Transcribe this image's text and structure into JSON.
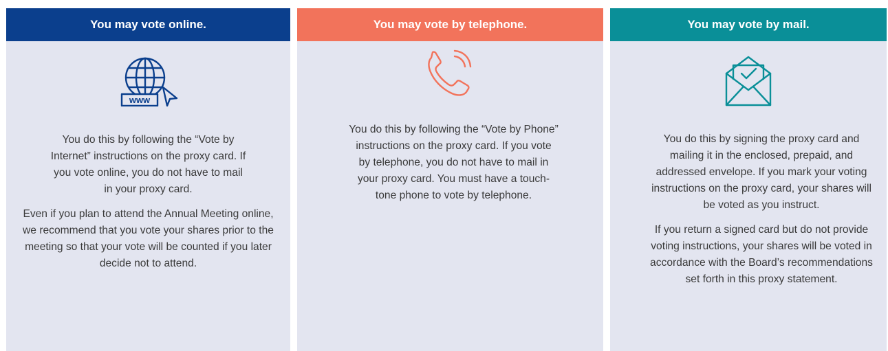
{
  "columns": [
    {
      "title": "You may vote online.",
      "icon": "globe-www-cursor-icon",
      "color": "#0b3f8d",
      "icon_text": "www",
      "paragraphs": [
        "You do this by following the “Vote by Internet” instructions on the proxy card. If you vote online, you do not have to mail in your proxy card.",
        "Even if you plan to attend the Annual Meeting online, we recommend that you vote your shares prior to the meeting so that your vote will be counted if you later decide not to attend."
      ]
    },
    {
      "title": "You may vote by telephone.",
      "icon": "phone-ringing-icon",
      "color": "#f2735b",
      "paragraphs": [
        "You do this by following the “Vote by Phone” instructions on the proxy card. If you vote by telephone, you do not have to mail in your proxy card. You must have a touch-tone phone to vote by telephone."
      ]
    },
    {
      "title": "You may vote by mail.",
      "icon": "envelope-check-icon",
      "color": "#0a8f98",
      "paragraphs": [
        "You do this by signing the proxy card and mailing it in the enclosed, prepaid, and addressed envelope. If you mark your voting instructions on the proxy card, your shares will be voted as you instruct.",
        "If you return a signed card but do not provide voting instructions, your shares will be voted in accordance with the Board’s recommendations set forth in this proxy statement."
      ]
    }
  ],
  "background_color": "#e3e5f0"
}
